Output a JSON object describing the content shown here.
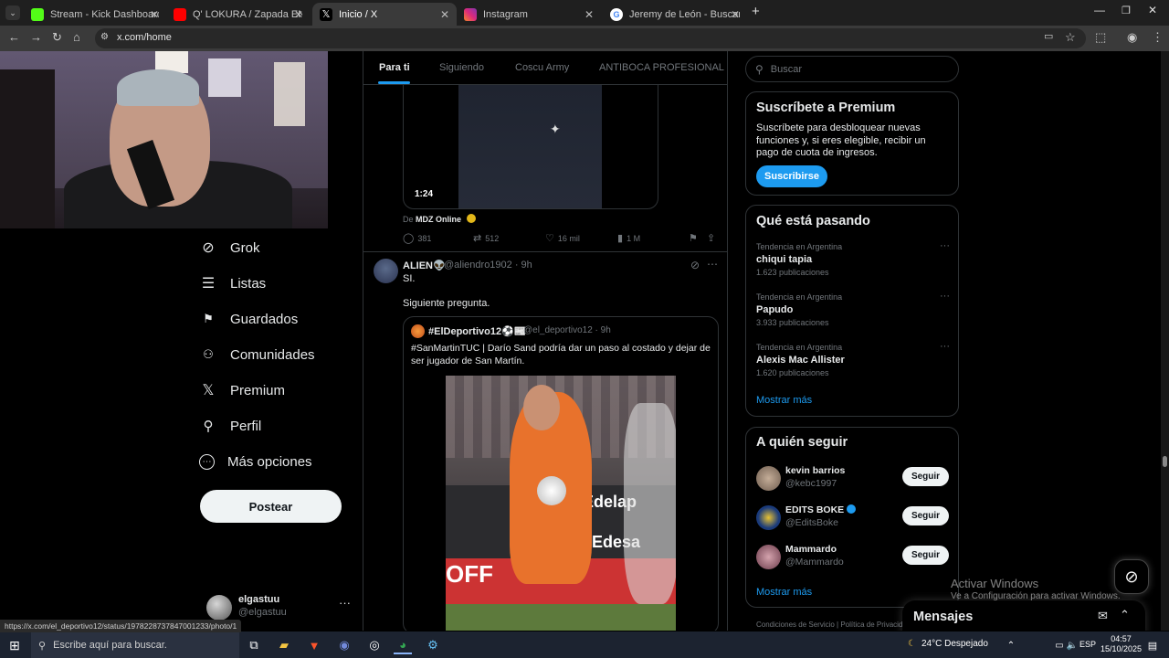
{
  "browser": {
    "tabs": [
      {
        "title": "Stream - Kick Dashboard",
        "icon": "kick-icon",
        "color": "#53fc18"
      },
      {
        "title": "Q' LOKURA / Zapada EN VIVO",
        "icon": "youtube-icon",
        "color": "#ff0000"
      },
      {
        "title": "Inicio / X",
        "icon": "x-icon",
        "color": "#000000"
      },
      {
        "title": "Instagram",
        "icon": "instagram-icon",
        "color": "#e1306c"
      },
      {
        "title": "Jeremy de León - Buscar con G",
        "icon": "google-icon",
        "color": "#ffffff"
      }
    ],
    "new_tab": "+",
    "url": "x.com/home",
    "status_url": "https://x.com/el_deportivo12/status/1978228737847001233/photo/1"
  },
  "sidebar": {
    "items": [
      {
        "label": "Grok",
        "icon": "grok-icon",
        "glyph": "⊘"
      },
      {
        "label": "Listas",
        "icon": "list-icon",
        "glyph": "☰"
      },
      {
        "label": "Guardados",
        "icon": "bookmark-icon",
        "glyph": "🔖"
      },
      {
        "label": "Comunidades",
        "icon": "communities-icon",
        "glyph": "👥"
      },
      {
        "label": "Premium",
        "icon": "x-premium-icon",
        "glyph": "𝕏"
      },
      {
        "label": "Perfil",
        "icon": "profile-icon",
        "glyph": "👤"
      },
      {
        "label": "Más opciones",
        "icon": "more-options-icon",
        "glyph": "⋯"
      }
    ],
    "post_button": "Postear",
    "account": {
      "name": "elgastuu",
      "handle": "@elgastuu",
      "more": "···"
    }
  },
  "feed": {
    "tabs": [
      {
        "label": "Para ti",
        "active": true
      },
      {
        "label": "Siguiendo",
        "active": false
      },
      {
        "label": "Coscu Army",
        "active": false
      },
      {
        "label": "ANTIBOCA PROFESIONAL",
        "active": false
      }
    ],
    "tweet1": {
      "duration": "1:24",
      "source_prefix": "De",
      "source_name": "MDZ Online",
      "replies": "381",
      "retweets": "512",
      "likes": "16 mil",
      "views": "1 M"
    },
    "tweet2": {
      "name": "ALIEN👽",
      "handle": "@aliendro1902 · 9h",
      "text1": "SI.",
      "text2": "Siguiente pregunta.",
      "quote": {
        "name": "#ElDeportivo12⚽📰",
        "handle": "@el_deportivo12 · 9h",
        "text": "#SanMartinTUC | Darío Sand podría dar un paso al costado y dejar de ser jugador de San Martín.",
        "photo_texts": [
          "Edelap",
          "Edesa",
          "OFF"
        ]
      }
    }
  },
  "right": {
    "search_placeholder": "Buscar",
    "premium": {
      "title": "Suscríbete a Premium",
      "body": "Suscríbete para desbloquear nuevas funciones y, si eres elegible, recibir un pago de cuota de ingresos.",
      "button": "Suscribirse"
    },
    "trends": {
      "title": "Qué está pasando",
      "items": [
        {
          "context": "Tendencia en Argentina",
          "name": "chiqui tapia",
          "count": "1.623 publicaciones"
        },
        {
          "context": "Tendencia en Argentina",
          "name": "Papudo",
          "count": "3.933 publicaciones"
        },
        {
          "context": "Tendencia en Argentina",
          "name": "Alexis Mac Allister",
          "count": "1.620 publicaciones"
        }
      ],
      "more": "Mostrar más"
    },
    "follow": {
      "title": "A quién seguir",
      "users": [
        {
          "name": "kevin barrios",
          "handle": "@kebc1997",
          "button": "Seguir",
          "color": "#8a7a6a"
        },
        {
          "name": "EDITS BOKE",
          "handle": "@EditsBoke",
          "button": "Seguir",
          "color": "#1a3a7a"
        },
        {
          "name": "Mammardo",
          "handle": "@Mammardo",
          "button": "Seguir",
          "color": "#9a6a7a"
        }
      ],
      "more": "Mostrar más"
    },
    "footer": "Condiciones de Servicio  |  Política de Privacidad",
    "messages": "Mensajes"
  },
  "watermark": {
    "line1": "Activar Windows",
    "line2": "Ve a Configuración para activar Windows."
  },
  "taskbar": {
    "search_placeholder": "Escribe aquí para buscar.",
    "weather": "24°C  Despejado",
    "lang": "ESP",
    "time": "04:57",
    "date": "15/10/2025"
  }
}
